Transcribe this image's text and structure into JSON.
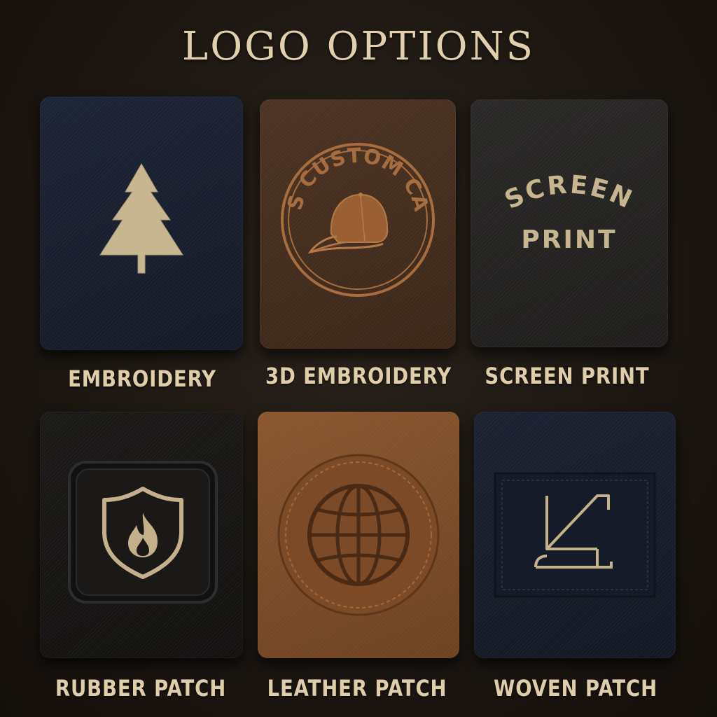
{
  "title": "LOGO OPTIONS",
  "options": [
    {
      "label": "EMBROIDERY",
      "icon": "pine-tree-icon"
    },
    {
      "label": "3D EMBROIDERY",
      "icon": "cap-badge-icon",
      "badge_text": "US CUSTOM CAP"
    },
    {
      "label": "SCREEN PRINT",
      "icon": "text-print",
      "print_line1": "SCREEN",
      "print_line2": "PRINT"
    },
    {
      "label": "RUBBER PATCH",
      "icon": "shield-flame-icon"
    },
    {
      "label": "LEATHER PATCH",
      "icon": "globe-icon"
    },
    {
      "label": "WOVEN PATCH",
      "icon": "monogram-icon"
    }
  ],
  "colors": {
    "background": "#1d1712",
    "text": "#e0cdaa",
    "thread": "#cbb894",
    "stitch_brown": "#a0683c",
    "leather": "#7c4c28"
  }
}
